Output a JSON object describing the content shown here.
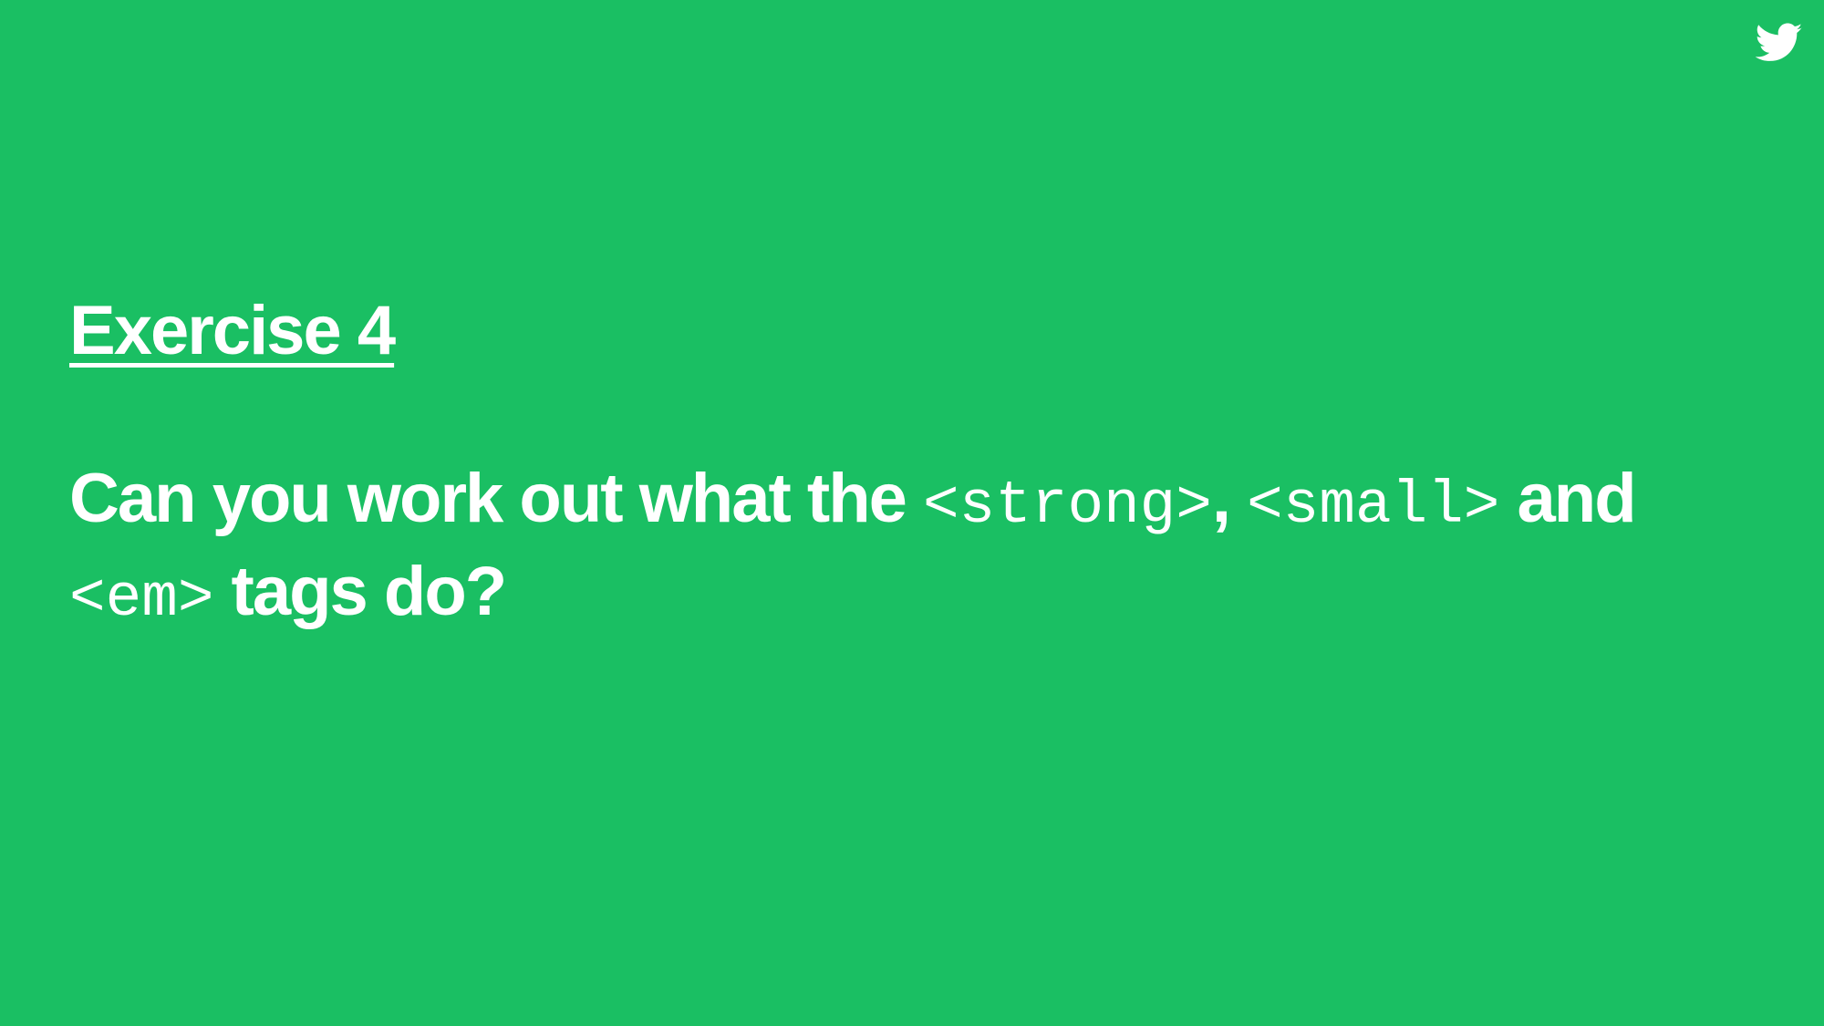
{
  "slide": {
    "icon": "twitter-bird-icon",
    "background_color": "#1abf63",
    "text_color": "#ffffff",
    "title": "Exercise 4",
    "question": {
      "text_1": "Can you work out what the ",
      "code_strong": "<strong>",
      "text_2": ", ",
      "code_small": "<small>",
      "text_3": " and ",
      "code_em": "<em>",
      "text_4": " tags do?"
    }
  }
}
